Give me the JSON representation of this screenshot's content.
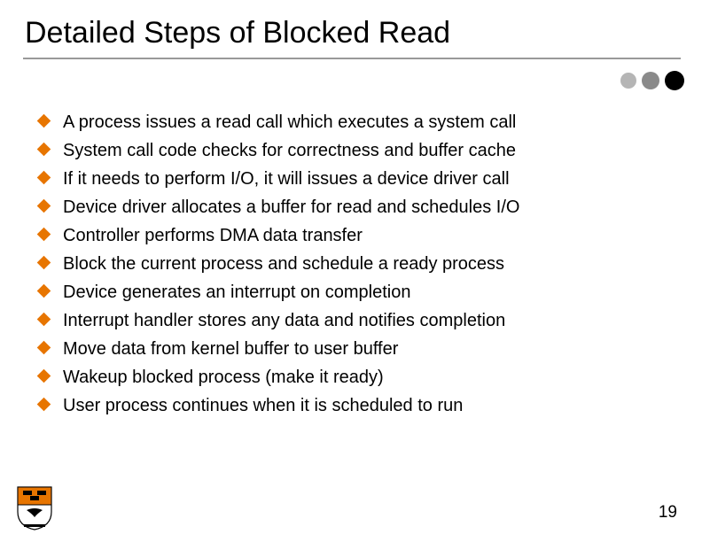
{
  "title": "Detailed Steps of Blocked Read",
  "items": [
    "A process issues a read call which executes a system call",
    "System call code checks for correctness and buffer cache",
    "If it needs to perform I/O, it will issues a device driver call",
    "Device driver allocates a buffer for read and schedules I/O",
    "Controller performs DMA data transfer",
    "Block the current process and schedule a ready process",
    "Device generates an interrupt on completion",
    "Interrupt handler stores any data and notifies completion",
    "Move data from kernel buffer to user buffer",
    "Wakeup blocked process (make it ready)",
    "User process continues when it is scheduled to run"
  ],
  "pageNumber": "19",
  "colors": {
    "accent": "#e77500"
  }
}
